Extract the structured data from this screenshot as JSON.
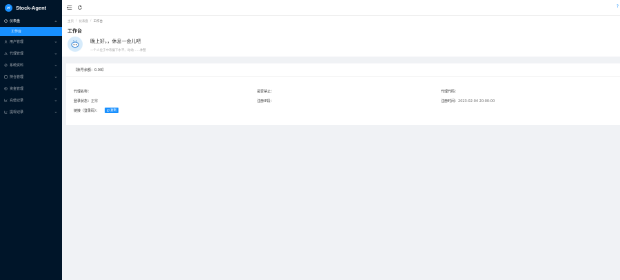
{
  "app": {
    "name": "Stock-Agent",
    "colors": {
      "sidebar": "#001529",
      "accent": "#1890ff",
      "background": "#f0f2f5"
    }
  },
  "sidebar": {
    "items": [
      {
        "label": "仪表盘",
        "icon": "dashboard-icon",
        "expanded": true
      },
      {
        "label": "用户管理",
        "icon": "user-icon"
      },
      {
        "label": "代理管理",
        "icon": "agent-icon"
      },
      {
        "label": "系统资料",
        "icon": "system-icon"
      },
      {
        "label": "持仓管理",
        "icon": "position-icon"
      },
      {
        "label": "资金管理",
        "icon": "money-icon"
      },
      {
        "label": "充值记录",
        "icon": "record-icon"
      },
      {
        "label": "提现记录",
        "icon": "record-icon"
      }
    ],
    "sub_items": [
      {
        "label": "工作台"
      }
    ]
  },
  "topbar": {
    "menu_icon": "menu-fold-icon",
    "refresh_icon": "refresh-icon",
    "help": "?"
  },
  "page": {
    "breadcrumb": [
      "主页",
      "仪表盘",
      "工作台"
    ],
    "breadcrumb_sep": "/",
    "title": "工作台",
    "greeting": "晚上好，，休息一会儿吧",
    "greeting_sub": "一个人位于中等偏下水平，动动……休整"
  },
  "card": {
    "header": "【账号余额：0.00】",
    "fields": {
      "agent_name_label": "代理名称：",
      "agent_name_value": "",
      "agent_status_label": "是否禁止：",
      "agent_status_value": "",
      "agent_code_label": "代理代码：",
      "agent_code_value": "",
      "login_status_label": "登录状态：",
      "login_status_value": "正常",
      "register_ip_label": "注册IP段：",
      "register_ip_value": "",
      "register_time_label": "注册时间：",
      "register_time_value": "2023-02-04 20:00:00",
      "link_label": "链接（登录码）：",
      "link_tag": "复制"
    }
  }
}
